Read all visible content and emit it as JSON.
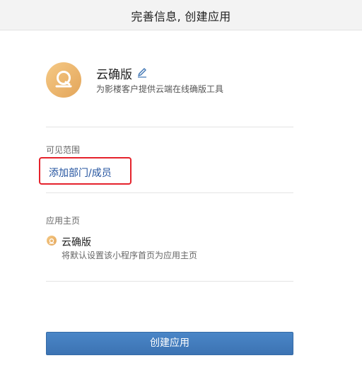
{
  "titlebar": {
    "title": "完善信息, 创建应用"
  },
  "app": {
    "name": "云确版",
    "description": "为影楼客户提供云端在线确版工具",
    "logo_icon": "q-logo-icon",
    "edit_icon": "pencil-icon",
    "logo_color": "#e8ae62"
  },
  "visibility": {
    "label": "可见范围",
    "add_link": "添加部门/成员",
    "highlight_color": "#e5232c",
    "link_color": "#23539f"
  },
  "homepage": {
    "label": "应用主页",
    "item_name": "云确版",
    "item_desc": "将默认设置该小程序首页为应用主页",
    "item_icon": "q-logo-icon"
  },
  "actions": {
    "create_label": "创建应用",
    "button_color": "#4079bb"
  }
}
